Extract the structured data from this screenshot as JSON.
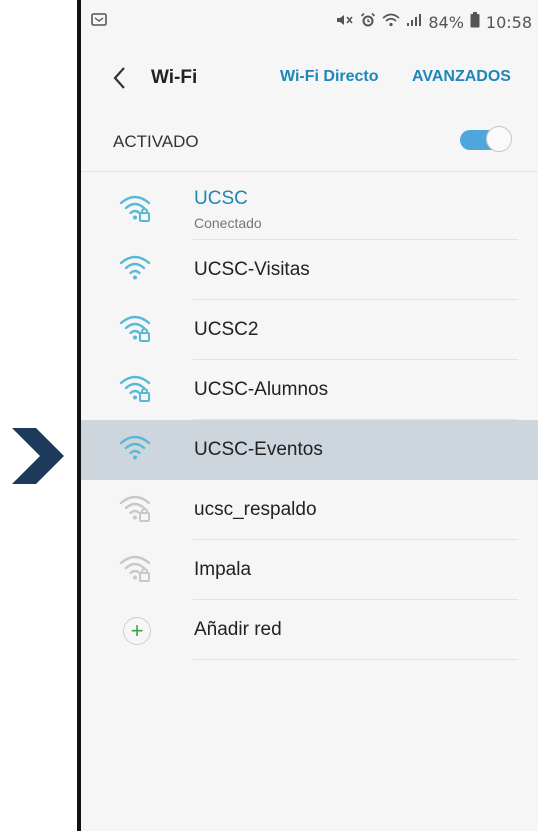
{
  "status_bar": {
    "battery_text": "84%",
    "time": "10:58"
  },
  "header": {
    "title": "Wi-Fi",
    "wifi_direct": "Wi-Fi Directo",
    "advanced": "AVANZADOS"
  },
  "toggle_row": {
    "label": "ACTIVADO",
    "state": "on"
  },
  "networks": [
    {
      "name": "UCSC",
      "status": "Conectado",
      "secured": true,
      "strength": "full"
    },
    {
      "name": "UCSC-Visitas",
      "secured": false,
      "strength": "full"
    },
    {
      "name": "UCSC2",
      "secured": true,
      "strength": "full"
    },
    {
      "name": "UCSC-Alumnos",
      "secured": true,
      "strength": "full"
    },
    {
      "name": "UCSC-Eventos",
      "secured": false,
      "strength": "full",
      "selected": true
    },
    {
      "name": "ucsc_respaldo",
      "secured": true,
      "strength": "weak"
    },
    {
      "name": "Impala",
      "secured": true,
      "strength": "weak"
    }
  ],
  "add_network": {
    "label": "Añadir red"
  },
  "colors": {
    "accent": "#1f86b8",
    "wifi_strong": "#58b9d6",
    "wifi_weak": "#c8c8c8",
    "selected_row": "#cdd5dd",
    "pointer": "#1e3a5a",
    "add_plus": "#3aa545"
  }
}
